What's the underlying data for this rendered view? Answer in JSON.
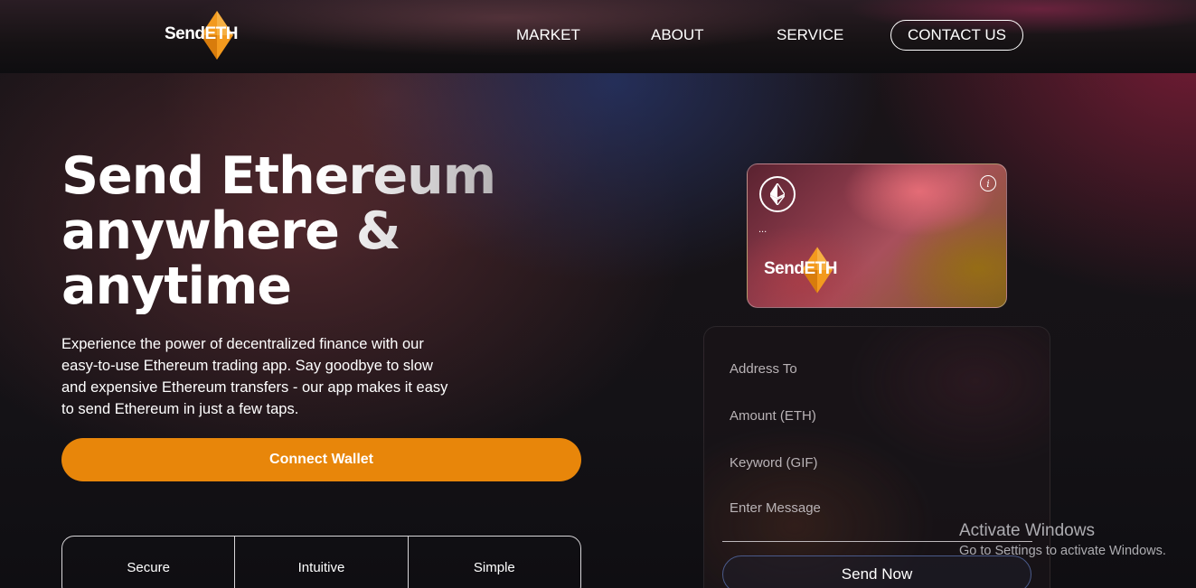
{
  "nav": {
    "logo_text": "SendETH",
    "links": [
      "MARKET",
      "ABOUT",
      "SERVICE"
    ],
    "contact_label": "CONTACT US"
  },
  "hero": {
    "title_lines": [
      "Send Ethereum",
      "anywhere &",
      "anytime"
    ],
    "description": "Experience the power of decentralized finance with our easy-to-use Ethereum trading app. Say goodbye to slow and expensive Ethereum transfers - our app makes it easy to send Ethereum in just a few taps.",
    "connect_label": "Connect Wallet",
    "features": [
      "Secure",
      "Intuitive",
      "Simple"
    ]
  },
  "card": {
    "address_text": "...",
    "logo_text": "SendETH",
    "info_glyph": "i"
  },
  "form": {
    "address_placeholder": "Address To",
    "amount_placeholder": "Amount (ETH)",
    "keyword_placeholder": "Keyword (GIF)",
    "message_placeholder": "Enter Message",
    "send_label": "Send Now"
  },
  "watermark": {
    "title": "Activate Windows",
    "subtitle": "Go to Settings to activate Windows."
  },
  "colors": {
    "accent": "#e8860a",
    "logo_orange": "#f39a1e",
    "background": "#121114"
  },
  "icons": {
    "ethereum": "ethereum-icon",
    "info": "info-icon",
    "logo": "diamond-logo-icon"
  }
}
